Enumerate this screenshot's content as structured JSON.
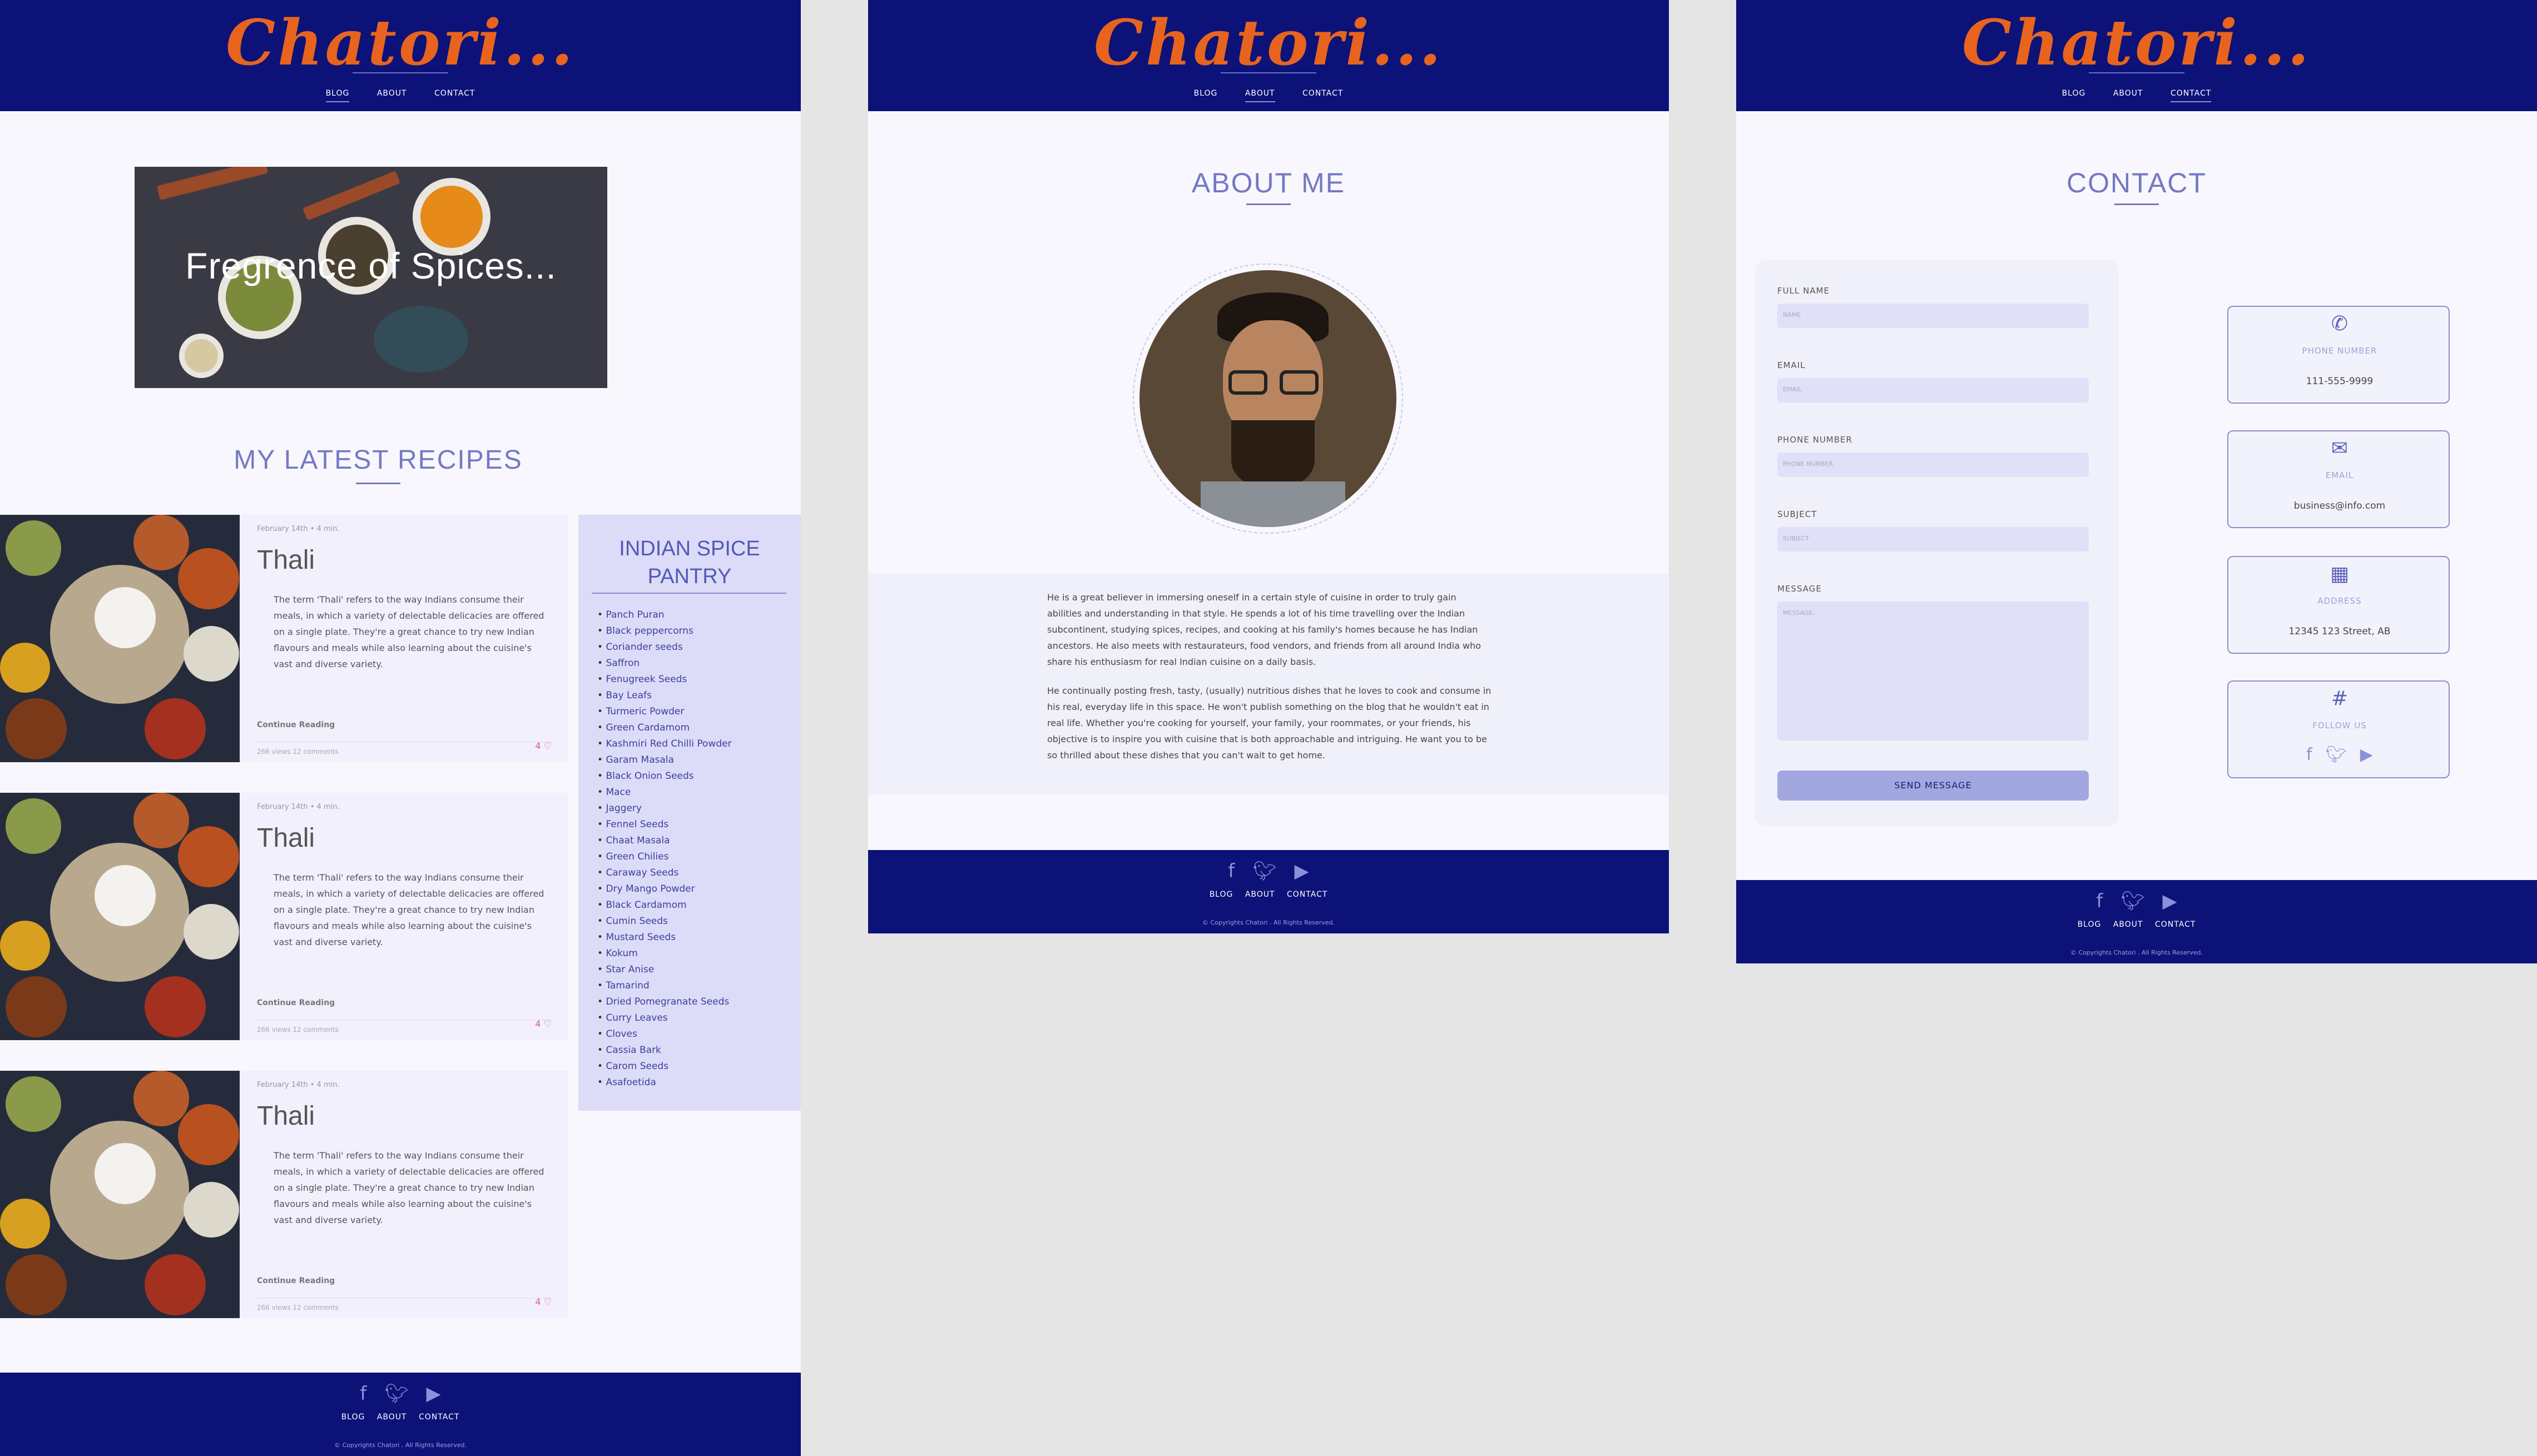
{
  "brand": {
    "logo": "Chatori..."
  },
  "nav": [
    "BLOG",
    "ABOUT",
    "CONTACT"
  ],
  "footer": {
    "nav": [
      "BLOG",
      "ABOUT",
      "CONTACT"
    ],
    "copyright": "© Copyrights Chatori . All Rights Reserved.",
    "social": [
      "facebook-icon",
      "twitter-icon",
      "youtube-icon"
    ]
  },
  "blog": {
    "hero_text": "Fregrence of Spices...",
    "section_title": "MY LATEST RECIPES",
    "posts": [
      {
        "meta": "February 14th  •  4 min.",
        "title": "Thali",
        "excerpt": "The term 'Thali' refers to the way Indians consume their meals, in which a variety of delectable delicacies are offered on a single plate. They're a great chance to try new Indian flavours and meals while also learning about the cuisine's vast and diverse variety.",
        "more": "Continue Reading",
        "stats": "266 views   12 comments",
        "likes": "4"
      },
      {
        "meta": "February 14th  •  4 min.",
        "title": "Thali",
        "excerpt": "The term 'Thali' refers to the way Indians consume their meals, in which a variety of delectable delicacies are offered on a single plate. They're a great chance to try new Indian flavours and meals while also learning about the cuisine's vast and diverse variety.",
        "more": "Continue Reading",
        "stats": "266 views   12 comments",
        "likes": "4"
      },
      {
        "meta": "February 14th  •  4 min.",
        "title": "Thali",
        "excerpt": "The term 'Thali' refers to the way Indians consume their meals, in which a variety of delectable delicacies are offered on a single plate. They're a great chance to try new Indian flavours and meals while also learning about the cuisine's vast and diverse variety.",
        "more": "Continue Reading",
        "stats": "266 views   12 comments",
        "likes": "4"
      }
    ],
    "pantry_title": "INDIAN SPICE PANTRY",
    "pantry_items": [
      "Panch Puran",
      "Black peppercorns",
      "Coriander seeds",
      "Saffron",
      "Fenugreek Seeds",
      "Bay Leafs",
      "Turmeric Powder",
      "Green Cardamom",
      "Kashmiri Red Chilli Powder",
      "Garam Masala",
      "Black Onion Seeds",
      "Mace",
      "Jaggery",
      "Fennel Seeds",
      "Chaat Masala",
      "Green Chilies",
      "Caraway Seeds",
      "Dry Mango Powder",
      "Black Cardamom",
      "Cumin Seeds",
      "Mustard Seeds",
      "Kokum",
      "Star Anise",
      "Tamarind",
      "Dried Pomegranate Seeds",
      "Curry Leaves",
      "Cloves",
      "Cassia Bark",
      "Carom Seeds",
      "Asafoetida"
    ]
  },
  "about": {
    "title": "ABOUT ME",
    "para1": "He is a great believer in immersing oneself in a certain style of cuisine in order to truly gain abilities and understanding in that style. He spends a lot of his time travelling over the Indian subcontinent, studying spices, recipes, and cooking at his family's homes because he has Indian ancestors. He also meets with restaurateurs, food vendors, and friends from all around India who share his enthusiasm for real Indian cuisine on a daily basis.",
    "para2": "He continually posting fresh, tasty, (usually) nutritious dishes that he loves to cook and consume in his real, everyday life in this space. He won't publish something on the blog that he wouldn't eat in real life. Whether you're cooking for yourself, your family, your roommates, or your friends, his objective is to inspire you with cuisine that is both approachable and intriguing. He want you to be so thrilled about these dishes that you can't wait to get home."
  },
  "contact": {
    "title": "CONTACT",
    "fields": [
      {
        "label": "FULL NAME",
        "placeholder": "NAME"
      },
      {
        "label": "EMAIL",
        "placeholder": "EMAIL"
      },
      {
        "label": "PHONE NUMBER",
        "placeholder": "PHONE NUMBER"
      },
      {
        "label": "SUBJECT",
        "placeholder": "SUBJECT"
      },
      {
        "label": "MESSAGE",
        "placeholder": "MESSAGE..."
      }
    ],
    "send": "SEND MESSAGE",
    "info": [
      {
        "icon": "phone-icon",
        "label": "PHONE NUMBER",
        "value": "111-555-9999"
      },
      {
        "icon": "envelope-icon",
        "label": "EMAIL",
        "value": "business@info.com"
      },
      {
        "icon": "map-icon",
        "label": "ADDRESS",
        "value": "12345 123 Street, AB"
      },
      {
        "icon": "hash-icon",
        "label": "FOLLOW US"
      }
    ]
  },
  "colors": {
    "header": "#0c1278",
    "logo": "#e8641e",
    "accent": "#7479c4",
    "page": "#f8f7fd",
    "pantry": "#dcdcf8"
  }
}
